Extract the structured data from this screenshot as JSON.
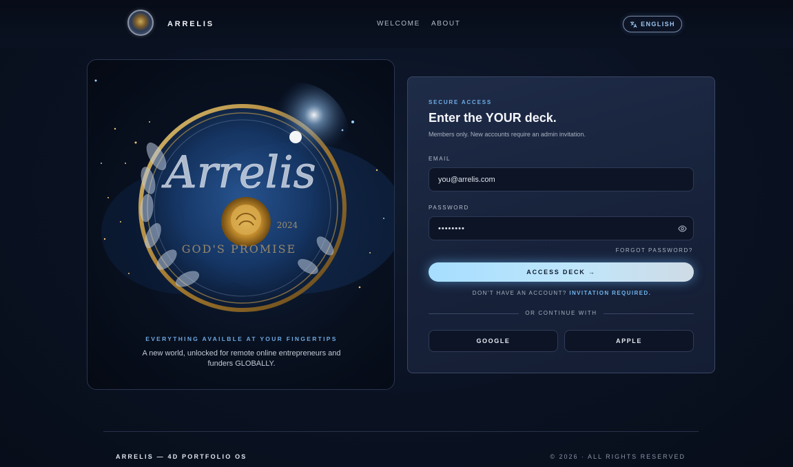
{
  "header": {
    "brand": "ARRELIS",
    "nav": [
      "WELCOME",
      "ABOUT"
    ],
    "language": "ENGLISH"
  },
  "hero": {
    "emblem_script": "Arrelis",
    "emblem_year": "2024",
    "emblem_motto": "GOD'S PROMISE",
    "tagline": "EVERYTHING AVAILBLE AT YOUR FINGERTIPS",
    "description": "A new world, unlocked for remote online entrepreneurs and funders GLOBALLY."
  },
  "login": {
    "eyebrow": "SECURE ACCESS",
    "heading": "Enter the YOUR deck.",
    "subtext": "Members only. New accounts require an admin invitation.",
    "email_label": "EMAIL",
    "email_placeholder": "you@arrelis.com",
    "password_label": "PASSWORD",
    "password_value": "••••••••",
    "forgot": "FORGOT PASSWORD?",
    "submit": "ACCESS DECK →",
    "signup_prompt": "DON'T HAVE AN ACCOUNT?",
    "signup_link": "INVITATION REQUIRED.",
    "divider": "OR CONTINUE WITH",
    "social": [
      "GOOGLE",
      "APPLE"
    ]
  },
  "footer": {
    "left": "ARRELIS — 4D PORTFOLIO OS",
    "right": "© 2026 · ALL RIGHTS RESERVED"
  },
  "colors": {
    "accent": "#6faee8",
    "button_gradient_start": "#a6deff",
    "background": "#0a1222"
  },
  "icons": {
    "language": "translate-icon",
    "password_toggle": "eye-icon",
    "logo": "arrelis-emblem-icon"
  }
}
